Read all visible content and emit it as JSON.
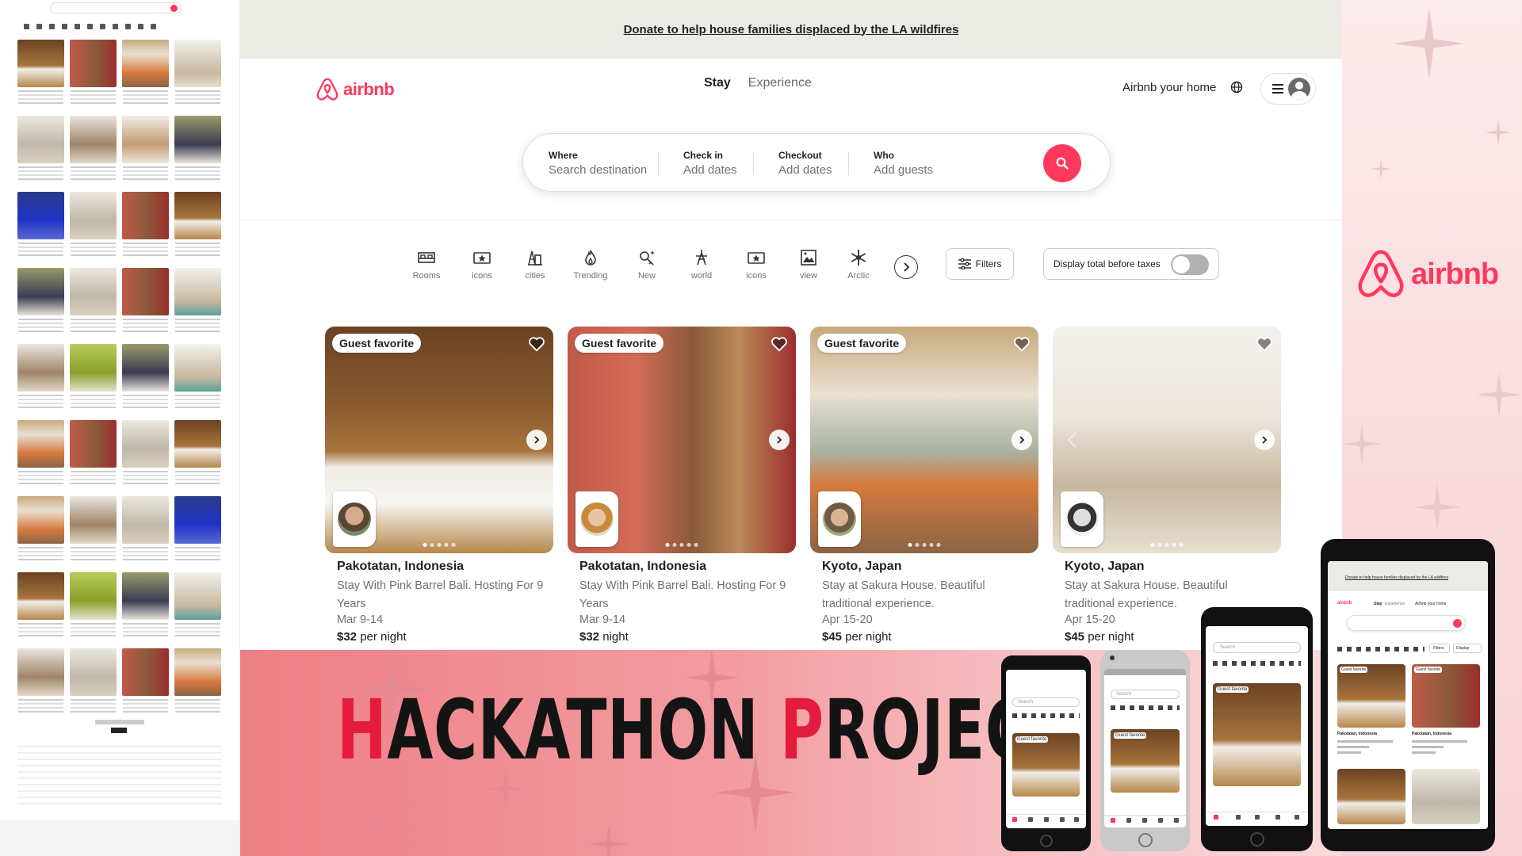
{
  "banner": {
    "text": "Donate to help house families displaced by the LA wildfires"
  },
  "header": {
    "logo_text": "airbnb",
    "tabs": [
      {
        "label": "Stay",
        "active": true
      },
      {
        "label": "Experience",
        "active": false
      }
    ],
    "host_link": "Airbnb your home",
    "globe_icon": "globe-icon",
    "menu_icon": "hamburger-menu-icon",
    "avatar_icon": "user-avatar-icon"
  },
  "search": {
    "fields": [
      {
        "label": "Where",
        "placeholder": "Search destination"
      },
      {
        "label": "Check in",
        "placeholder": "Add dates"
      },
      {
        "label": "Checkout",
        "placeholder": "Add dates"
      },
      {
        "label": "Who",
        "placeholder": "Add guests"
      }
    ],
    "button_icon": "search-icon"
  },
  "categories": [
    {
      "label": "Rooms",
      "icon": "bed-icon"
    },
    {
      "label": "icons",
      "icon": "star-ticket-icon"
    },
    {
      "label": "cities",
      "icon": "city-icon"
    },
    {
      "label": "Trending",
      "icon": "flame-icon"
    },
    {
      "label": "New",
      "icon": "sparkle-key-icon"
    },
    {
      "label": "world",
      "icon": "landmark-icon"
    },
    {
      "label": "icons",
      "icon": "star-ticket-icon"
    },
    {
      "label": "view",
      "icon": "view-icon"
    },
    {
      "label": "Arctic",
      "icon": "snowflake-icon"
    }
  ],
  "filters": {
    "filters_label": "Filters",
    "taxes_label": "Display total before taxes",
    "taxes_toggle_on": false
  },
  "listings": [
    {
      "badge": "Guest favorite",
      "title": "Pakotatan, Indonesia",
      "description": "Stay With Pink Barrel Bali. Hosting For 9 Years",
      "dates": "Mar 9-14",
      "price": "$32",
      "price_suffix": "per night"
    },
    {
      "badge": "Guest favorite",
      "title": "Pakotatan, Indonesia",
      "description": "Stay With Pink Barrel Bali. Hosting For 9 Years",
      "dates": "Mar 9-14",
      "price": "$32",
      "price_suffix": "night"
    },
    {
      "badge": "Guest favorite",
      "title": "Kyoto, Japan",
      "description": "Stay at Sakura House. Beautiful traditional experience.",
      "dates": "Apr 15-20",
      "price": "$45",
      "price_suffix": "per night"
    },
    {
      "badge": "",
      "title": "Kyoto, Japan",
      "description": "Stay at Sakura House. Beautiful traditional experience.",
      "dates": "Apr 15-20",
      "price": "$45",
      "price_suffix": "per night"
    }
  ],
  "headline": {
    "first_letter": "H",
    "word1_rest": "ACKATHON",
    "second_letter": "P",
    "word2_rest": "ROJECT"
  },
  "side_logo_text": "airbnb",
  "mockups": {
    "search_placeholder": "Search",
    "badge": "Guest favorite",
    "card1_title": "Pakotatan, Indonesia",
    "card2_title": "Pakotatan, Indonesia",
    "tablet_banner": "Donate to help house families displaced by the LA wildfires",
    "tablet_tabs": [
      "Stay",
      "Experience"
    ],
    "tablet_host": "Airbnb your home",
    "tablet_filters": "Filters",
    "tablet_display": "Display"
  },
  "colors": {
    "brand": "#FF385C",
    "banner_bg": "#EBEBE6",
    "headline_accent": "#E31C3D"
  }
}
